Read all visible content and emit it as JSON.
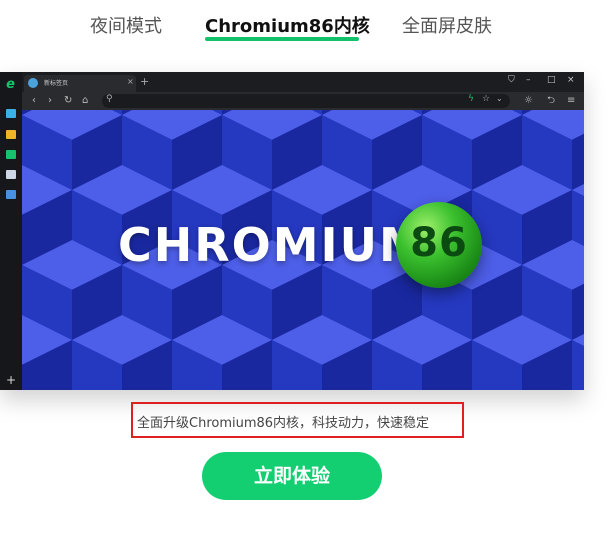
{
  "tabs": [
    {
      "label": "夜间模式",
      "active": false
    },
    {
      "label": "Chromium86内核",
      "active": true
    },
    {
      "label": "全面屏皮肤",
      "active": false
    }
  ],
  "colors": {
    "accent": "#12c26b",
    "cta_bg": "#13cf72",
    "caption_border": "#e02020",
    "stage_bg": "#2436b8"
  },
  "browser": {
    "tab_title": "新标签页",
    "icons": {
      "logo": "e-logo-icon",
      "back": "‹",
      "forward": "›",
      "reload": "↻",
      "home": "⌂",
      "search": "⚲",
      "bolt": "ϟ",
      "star": "☆",
      "dropdown": "⌄",
      "close": "×",
      "newtab": "+",
      "minimize": "–",
      "maximize": "□",
      "shirt": "⛉",
      "settings": "☼",
      "undo": "⮌",
      "menu": "≡"
    }
  },
  "hero": {
    "brand_text": "CHROMIUM",
    "version": "86"
  },
  "caption": "全面升级Chromium86内核，科技动力，快速稳定",
  "cta_label": "立即体验"
}
